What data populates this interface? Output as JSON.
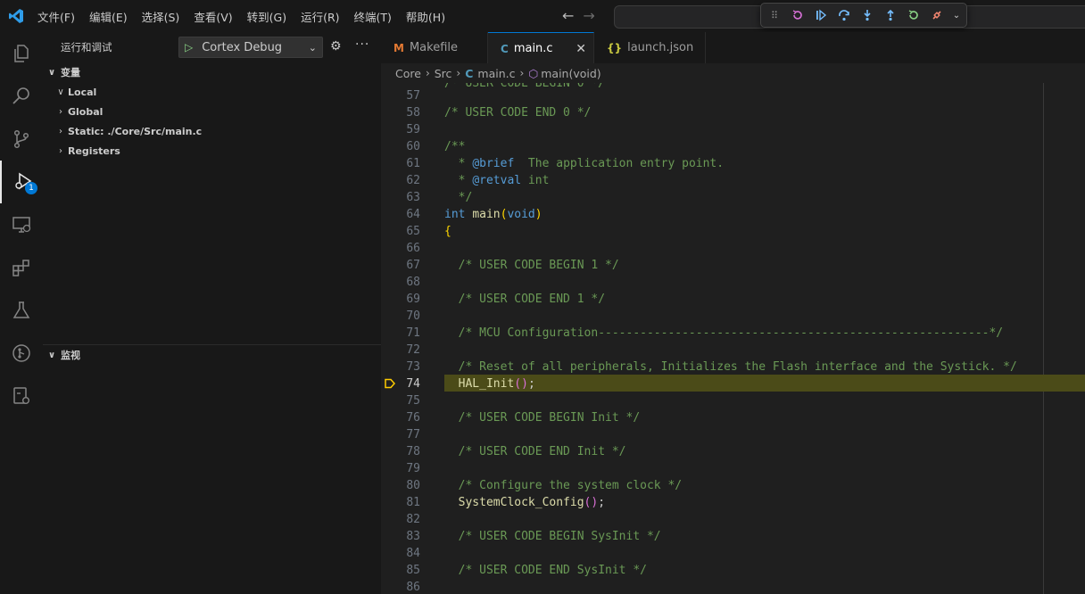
{
  "menu": [
    "文件(F)",
    "编辑(E)",
    "选择(S)",
    "查看(V)",
    "转到(G)",
    "运行(R)",
    "终端(T)",
    "帮助(H)"
  ],
  "activity_badge": "1",
  "run_panel": {
    "title": "运行和调试",
    "config": "Cortex Debug"
  },
  "variables": {
    "header": "变量",
    "items": [
      "Local",
      "Global",
      "Static: ./Core/Src/main.c",
      "Registers"
    ]
  },
  "watch": {
    "header": "监视"
  },
  "tabs": [
    {
      "icon": "M",
      "label": "Makefile"
    },
    {
      "icon": "C",
      "label": "main.c"
    },
    {
      "icon": "{}",
      "label": "launch.json"
    }
  ],
  "breadcrumb": {
    "folder1": "Core",
    "folder2": "Src",
    "file": "main.c",
    "symbol": "main(void)"
  },
  "editor": {
    "line_numbers": [
      "57",
      "58",
      "59",
      "60",
      "61",
      "62",
      "63",
      "64",
      "65",
      "66",
      "67",
      "68",
      "69",
      "70",
      "71",
      "72",
      "73",
      "74",
      "75",
      "76",
      "77",
      "78",
      "79",
      "80",
      "81",
      "82",
      "83",
      "84",
      "85",
      "86"
    ],
    "current_line": "74"
  },
  "colors": {
    "accent": "#0078d4",
    "highlight": "#4b4b18",
    "comment": "#6a9955",
    "keyword": "#569cd6",
    "function": "#dcdcaa"
  }
}
